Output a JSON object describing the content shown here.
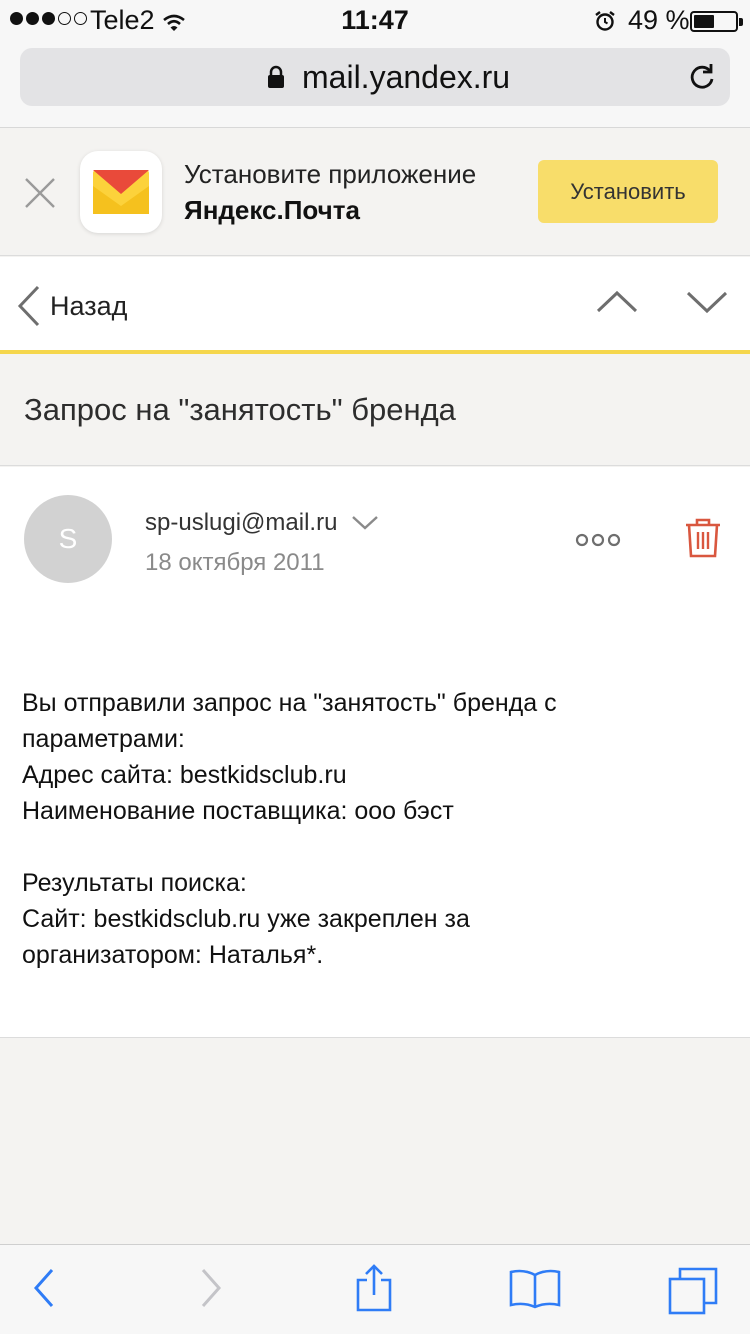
{
  "status": {
    "carrier": "Tele2",
    "time": "11:47",
    "battery": "49 %",
    "battery_level": 0.49,
    "signal_bars_filled": 3,
    "signal_bars_total": 5
  },
  "browser": {
    "url": "mail.yandex.ru"
  },
  "banner": {
    "line1": "Установите приложение",
    "line2": "Яндекс.Почта",
    "install_label": "Установить"
  },
  "nav": {
    "back_label": "Назад"
  },
  "message": {
    "subject": "Запрос на \"занятость\" бренда",
    "avatar_letter": "S",
    "sender": "sp-uslugi@mail.ru",
    "date": "18 октября 2011",
    "body_lines": [
      "Вы отправили запрос на \"занятость\" бренда с",
      "параметрами:",
      "Адрес сайта: bestkidsclub.ru",
      "Наименование поставщика: ооо бэст",
      "",
      "Результаты поиска:",
      "Сайт: bestkidsclub.ru уже закреплен за",
      "организатором: Наталья*."
    ]
  },
  "colors": {
    "accent_yellow": "#f8dd6a",
    "nav_underline": "#f5d64c",
    "trash_red": "#d9573f",
    "ios_blue": "#2f7cf6"
  }
}
